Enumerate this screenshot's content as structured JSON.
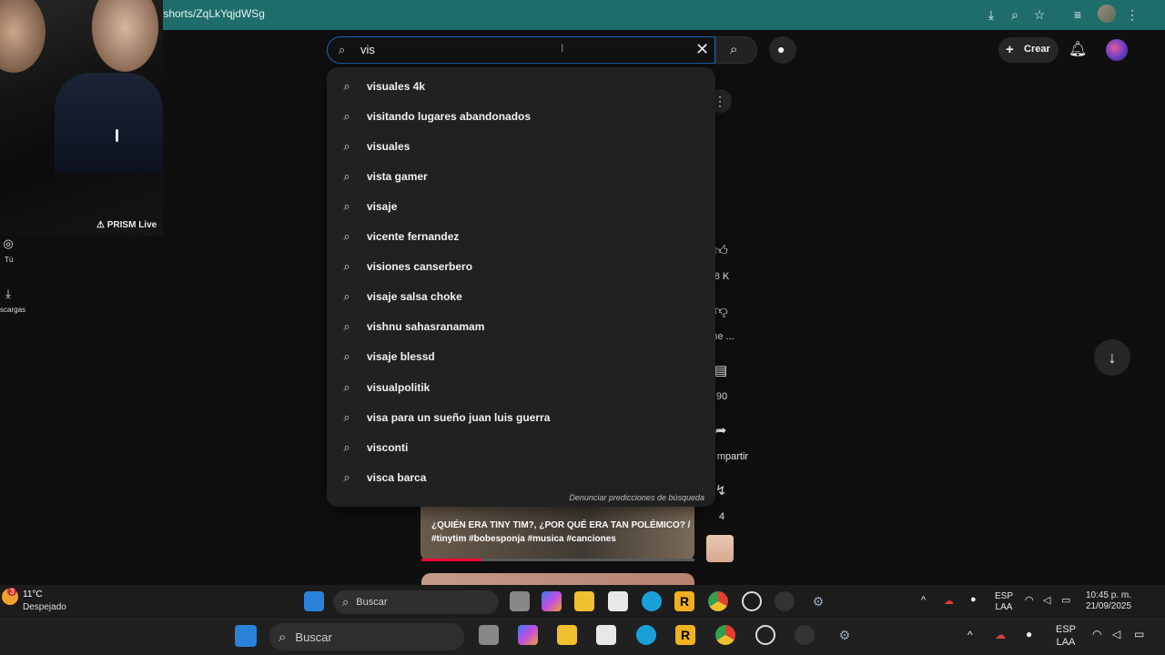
{
  "browser": {
    "url": "/shorts/ZqLkYqjdWSg",
    "icons": [
      "install-icon",
      "zoom-icon",
      "bookmark-star-icon",
      "tab-search-icon",
      "profile-avatar",
      "kebab-menu-icon"
    ]
  },
  "webcam": {
    "watermark": "PRISM Live"
  },
  "header": {
    "search_value": "vis",
    "create_label": "Crear"
  },
  "suggestions": [
    "visuales 4k",
    "visitando lugares abandonados",
    "visuales",
    "vista gamer",
    "visaje",
    "vicente fernandez",
    "visiones canserbero",
    "visaje salsa choke",
    "vishnu sahasranamam",
    "visaje blessd",
    "visualpolitik",
    "visa para un sueño juan luis guerra",
    "visconti",
    "visca barca"
  ],
  "report_predictions": "Denunciar predicciones de búsqueda",
  "rail": [
    {
      "label": "Tú"
    },
    {
      "label": "scargas"
    }
  ],
  "actions": {
    "likes": "8 K",
    "dislike": "o me ...",
    "comments": "90",
    "share": "mpartir",
    "remix": "4"
  },
  "short": {
    "title": "¿QUIÉN ERA TINY TIM?, ¿POR QUÉ ERA TAN POLÉMICO? / #tinytim #bobesponja #musica  #canciones",
    "progress": 0.22
  },
  "taskbar1": {
    "weather_temp": "11°C",
    "weather_desc": "Despejado",
    "weather_badge": "3",
    "search_label": "Buscar",
    "lang_top": "ESP",
    "lang_bottom": "LAA",
    "time": "10:45 p. m.",
    "date": "21/09/2025"
  },
  "taskbar2": {
    "search_label": "Buscar",
    "lang_top": "ESP",
    "lang_bottom": "LAA"
  }
}
